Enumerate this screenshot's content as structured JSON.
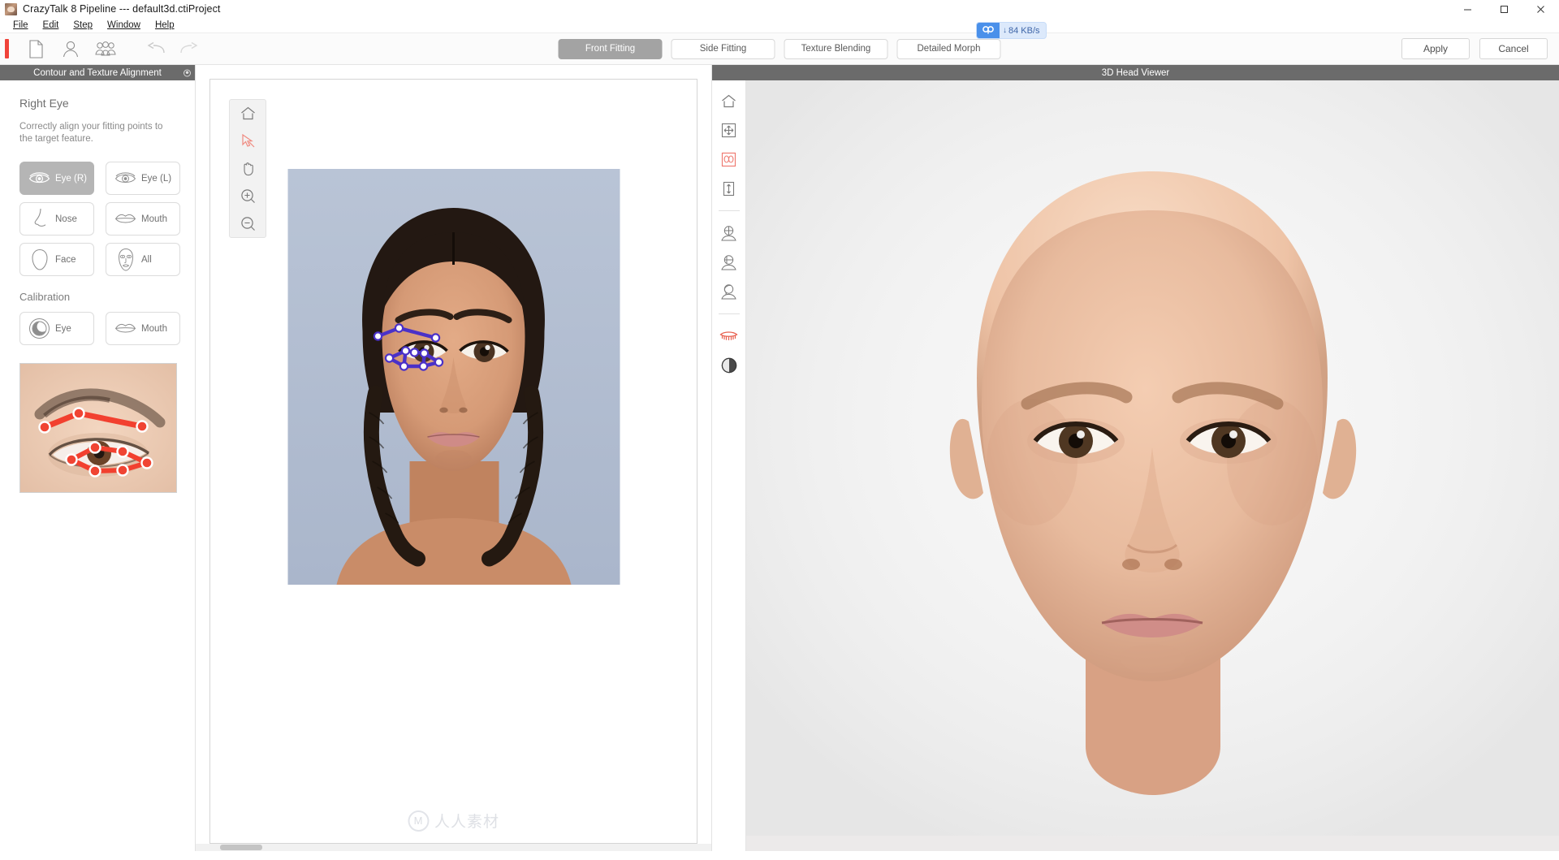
{
  "window": {
    "title": "CrazyTalk 8 Pipeline --- default3d.ctiProject",
    "app_icon": "crazytalk-app-icon",
    "minimize": "minimize-icon",
    "maximize": "maximize-icon",
    "close": "close-icon"
  },
  "menu": {
    "items": [
      {
        "label": "File",
        "accel": "F"
      },
      {
        "label": "Edit",
        "accel": "E"
      },
      {
        "label": "Step",
        "accel": "S"
      },
      {
        "label": "Window",
        "accel": "W"
      },
      {
        "label": "Help",
        "accel": "H"
      }
    ]
  },
  "toolbar": {
    "icons": [
      {
        "name": "new-project-icon",
        "title": "New"
      },
      {
        "name": "single-person-icon",
        "title": "Person"
      },
      {
        "name": "group-person-icon",
        "title": "Group"
      },
      {
        "name": "undo-icon",
        "title": "Undo"
      },
      {
        "name": "redo-icon",
        "title": "Redo"
      }
    ],
    "steps": [
      {
        "label": "Front Fitting",
        "active": true
      },
      {
        "label": "Side Fitting",
        "active": false
      },
      {
        "label": "Texture Blending",
        "active": false
      },
      {
        "label": "Detailed Morph",
        "active": false
      }
    ],
    "apply_label": "Apply",
    "cancel_label": "Cancel"
  },
  "network_badge": {
    "icon": "cloud-sync-icon",
    "direction": "↓",
    "speed": "84 KB/s"
  },
  "left_panel": {
    "header": "Contour and Texture Alignment",
    "pin_icon": "panel-pin-icon",
    "section_title": "Right Eye",
    "description": "Correctly align your fitting points to the target feature.",
    "feature_buttons": [
      {
        "label": "Eye (R)",
        "icon": "eye-right-icon",
        "active": true
      },
      {
        "label": "Eye (L)",
        "icon": "eye-left-icon",
        "active": false
      },
      {
        "label": "Nose",
        "icon": "nose-icon",
        "active": false
      },
      {
        "label": "Mouth",
        "icon": "mouth-icon",
        "active": false
      },
      {
        "label": "Face",
        "icon": "face-outline-icon",
        "active": false
      },
      {
        "label": "All",
        "icon": "all-features-icon",
        "active": false
      }
    ],
    "calibration_title": "Calibration",
    "calibration_buttons": [
      {
        "label": "Eye",
        "icon": "eye-calibration-icon",
        "active": false
      },
      {
        "label": "Mouth",
        "icon": "mouth-calibration-icon",
        "active": false
      }
    ],
    "thumbnail": {
      "name": "eye-contour-reference-thumbnail",
      "marker_color": "#f2402f"
    }
  },
  "canvas": {
    "tools": [
      {
        "name": "home-icon",
        "active": false
      },
      {
        "name": "select-cursor-icon",
        "active": true
      },
      {
        "name": "pan-hand-icon",
        "active": false
      },
      {
        "name": "zoom-in-icon",
        "active": false
      },
      {
        "name": "zoom-out-icon",
        "active": false
      }
    ],
    "photo": {
      "name": "front-face-photo",
      "overlay_color": "#4a31c8",
      "node_color": "#ffffff"
    },
    "watermark": {
      "mark": "M",
      "text": "人人素材"
    }
  },
  "viewer": {
    "header": "3D Head Viewer",
    "tools": [
      {
        "name": "home-icon",
        "active": false
      },
      {
        "name": "move-fit-icon",
        "active": false
      },
      {
        "name": "face-fitting-icon",
        "active": true
      },
      {
        "name": "vertical-scale-icon",
        "active": false
      },
      {
        "name": "head-front-view-icon",
        "active": false
      },
      {
        "name": "head-profile-view-icon",
        "active": false
      },
      {
        "name": "head-side-view-icon",
        "active": false
      },
      {
        "name": "eyelash-icon",
        "active": true
      },
      {
        "name": "shading-sphere-icon",
        "active": false
      }
    ],
    "model": {
      "name": "3d-head-model"
    }
  },
  "colors": {
    "accent_red": "#f0433a",
    "active_gray": "#a3a3a3",
    "panel_header": "#6b6b6b",
    "badge_blue": "#4a90ea",
    "contour_blue": "#4a31c8"
  }
}
